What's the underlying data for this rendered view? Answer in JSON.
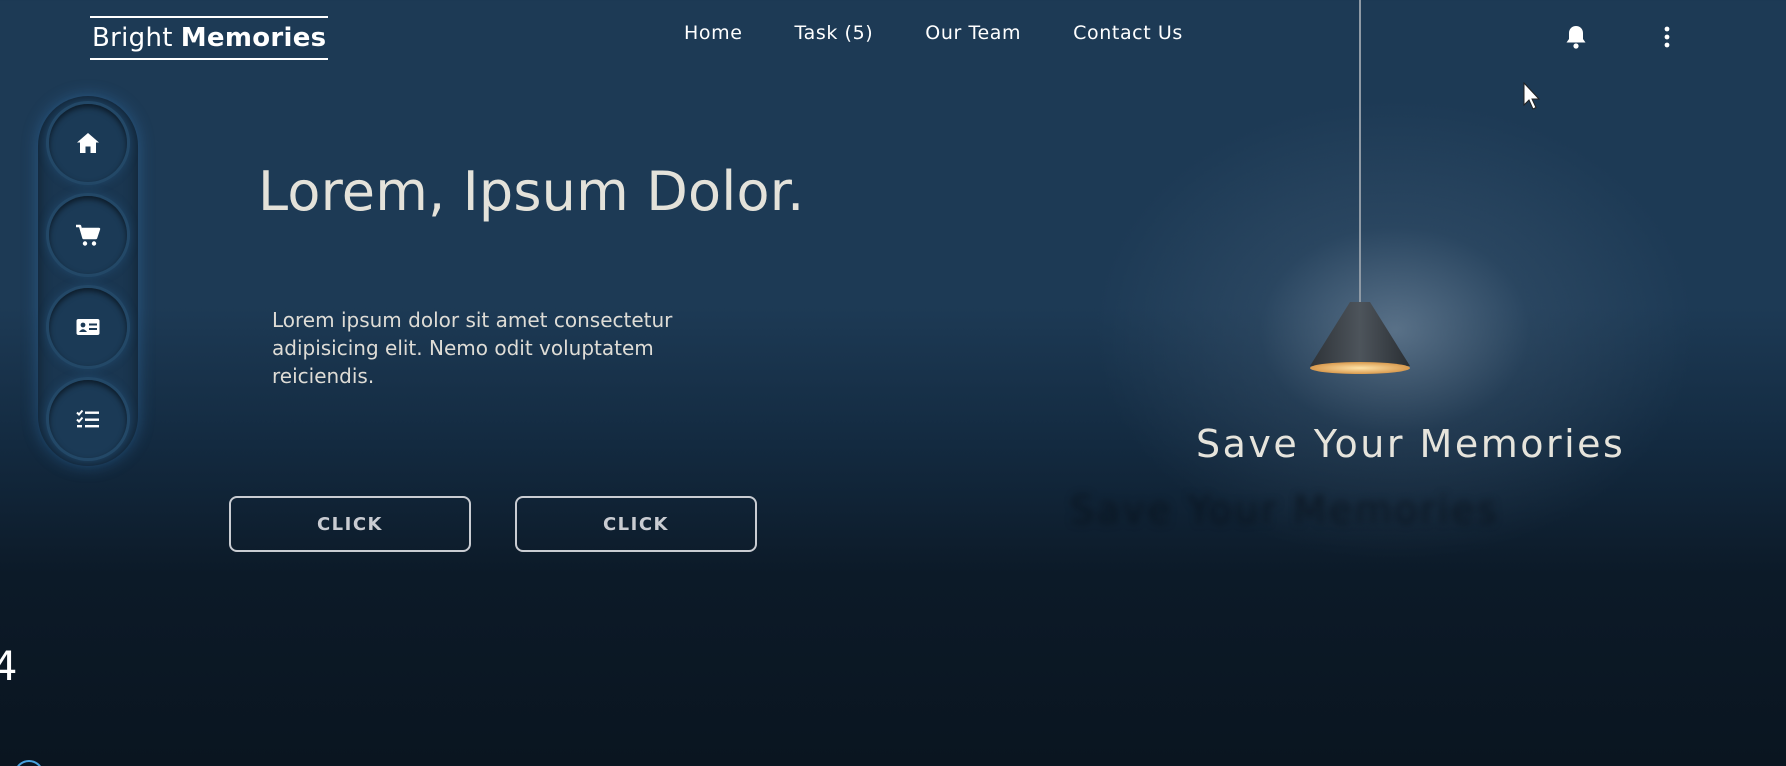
{
  "brand": {
    "name_light": "Bright",
    "name_bold": "Memories"
  },
  "nav": {
    "links": [
      "Home",
      "Task (5)",
      "Our Team",
      "Contact Us"
    ]
  },
  "header_icons": [
    "bell-icon",
    "kebab-menu-icon"
  ],
  "side_nav": {
    "items": [
      {
        "icon": "home-icon"
      },
      {
        "icon": "cart-icon"
      },
      {
        "icon": "contact-card-icon"
      },
      {
        "icon": "checklist-icon"
      }
    ]
  },
  "hero": {
    "title": "Lorem, Ipsum Dolor.",
    "text": "Lorem ipsum dolor sit amet consectetur adipisicing elit. Nemo odit voluptatem reiciendis.",
    "buttons": [
      "CLICK",
      "CLICK"
    ]
  },
  "feature": {
    "title": "Save Your Memories",
    "reflection": "Save Your Memories"
  },
  "edge_glyph": "4",
  "colors": {
    "bg_top": "#1d3a55",
    "bg_bottom": "#0a1520",
    "text": "#e4e2da",
    "button_border": "#c9ccd2",
    "lamp_glow": "#e8b56a",
    "accent_blue": "#4aa3e0"
  }
}
